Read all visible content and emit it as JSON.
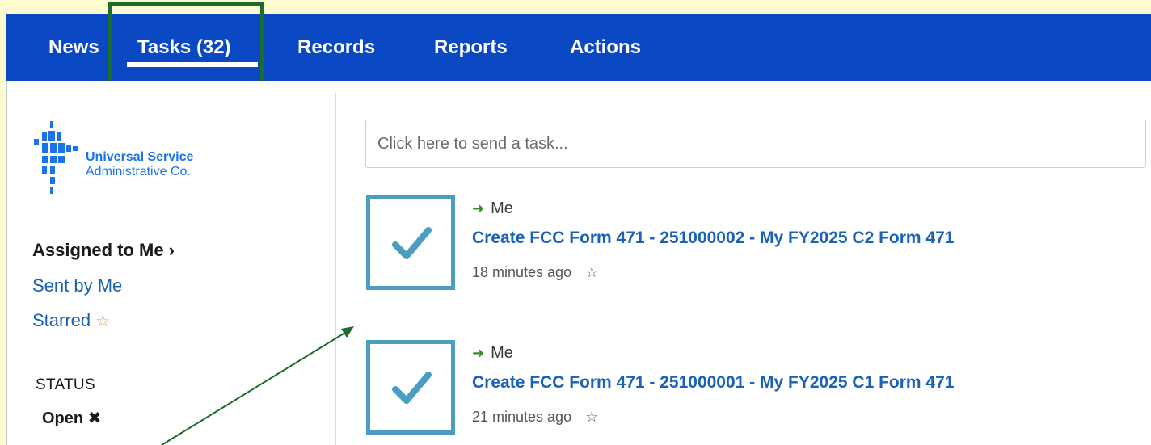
{
  "nav": {
    "items": [
      {
        "label": "News"
      },
      {
        "label": "Tasks (32)"
      },
      {
        "label": "Records"
      },
      {
        "label": "Reports"
      },
      {
        "label": "Actions"
      }
    ]
  },
  "logo": {
    "line1": "Universal Service",
    "line2": "Administrative Co."
  },
  "sidebar": {
    "assigned": "Assigned to Me ›",
    "sent": "Sent by Me",
    "starred": "Starred",
    "status_label": "STATUS",
    "status_value": "Open ✖"
  },
  "task_input": {
    "placeholder": "Click here to send a task..."
  },
  "tasks": [
    {
      "assignee": "Me",
      "title": "Create FCC Form 471 - 251000002 - My FY2025 C2 Form 471",
      "time": "18 minutes ago"
    },
    {
      "assignee": "Me",
      "title": "Create FCC Form 471 - 251000001 - My FY2025 C1 Form 471",
      "time": "21 minutes ago"
    }
  ],
  "colors": {
    "nav_bg": "#0a48c4",
    "page_bg": "#fffbd0",
    "highlight": "#1b6d2c",
    "checkbox": "#4a9ec2",
    "link": "#1a62b9",
    "star": "#f39b10"
  },
  "icons": [
    "arrow-right-icon",
    "checkmark-icon",
    "star-icon",
    "star-outline-icon",
    "close-icon"
  ]
}
